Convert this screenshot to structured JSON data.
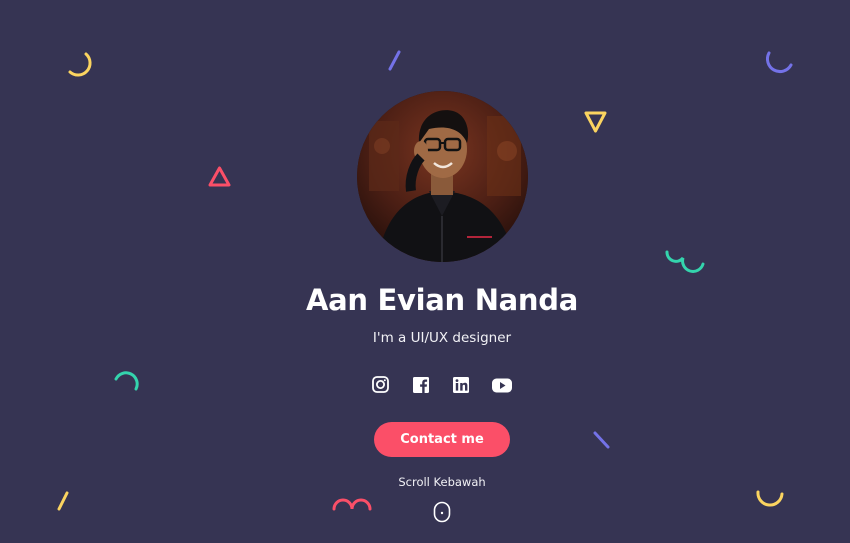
{
  "profile": {
    "name": "Aan Evian Nanda",
    "role": "I'm a UI/UX designer",
    "avatar_alt": "Profile photo"
  },
  "socials": [
    {
      "icon": "instagram-icon"
    },
    {
      "icon": "facebook-icon"
    },
    {
      "icon": "linkedin-icon"
    },
    {
      "icon": "youtube-icon"
    }
  ],
  "cta": {
    "contact_label": "Contact me"
  },
  "scroll": {
    "label": "Scroll Kebawah",
    "icon": "mouse-scroll-icon"
  },
  "colors": {
    "background": "#363453",
    "accent": "#fb4f68",
    "yellow": "#fbd460",
    "teal": "#34d4ad",
    "purple": "#7472e8",
    "text": "#ffffff"
  },
  "decorations": [
    "yellow-arc-icon",
    "purple-line-icon",
    "purple-arc-icon",
    "yellow-triangle-icon",
    "red-triangle-icon",
    "teal-wave-icon",
    "teal-arc-icon",
    "purple-line-icon",
    "yellow-line-icon",
    "red-wave-icon",
    "yellow-arc-icon"
  ]
}
